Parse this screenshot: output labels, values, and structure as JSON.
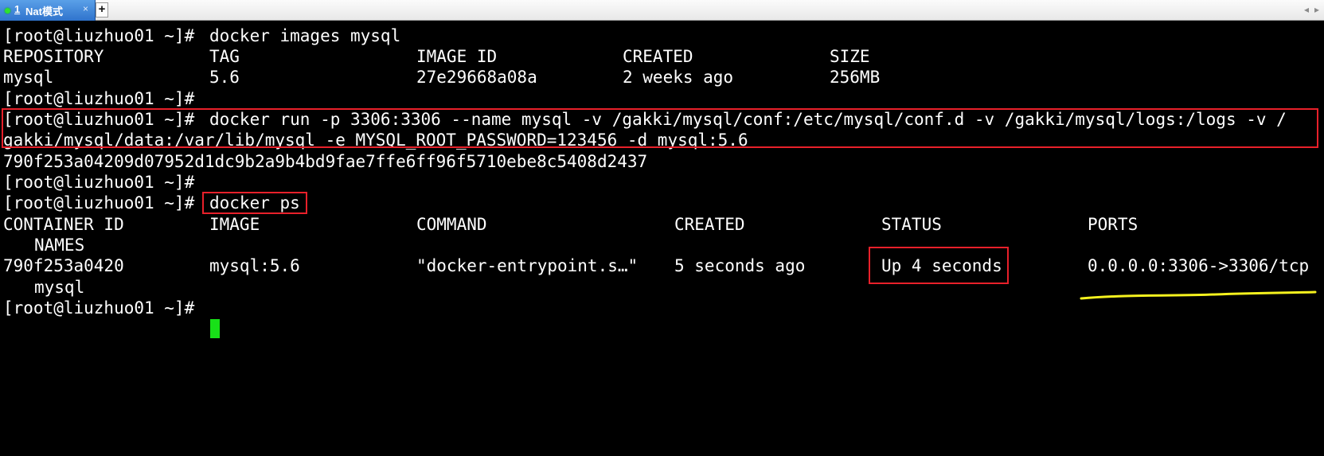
{
  "tab": {
    "number": "1",
    "name": "Nat模式",
    "close": "×",
    "add": "+",
    "nav_left": "◂",
    "nav_right": "▸",
    "status_color": "#2fe02f"
  },
  "terminal": {
    "prompt": "[root@liuzhuo01 ~]#",
    "cmd_images": "docker images mysql",
    "images_header": [
      "REPOSITORY",
      "TAG",
      "IMAGE ID",
      "CREATED",
      "SIZE"
    ],
    "images_row": [
      "mysql",
      "5.6",
      "27e29668a08a",
      "2 weeks ago",
      "256MB"
    ],
    "cmd_run_part1": "docker run -p 3306:3306 --name mysql -v /gakki/mysql/conf:/etc/mysql/conf.d -v /gakki/mysql/logs:/logs -v /",
    "cmd_run_part2": "gakki/mysql/data:/var/lib/mysql -e MYSQL_ROOT_PASSWORD=123456 -d mysql:5.6",
    "container_hash": "790f253a04209d07952d1dc9b2a9b4bd9fae7ffe6ff96f5710ebe8c5408d2437",
    "cmd_ps": "docker ps",
    "ps_header": [
      "CONTAINER ID",
      "IMAGE",
      "COMMAND",
      "CREATED",
      "STATUS",
      "PORTS"
    ],
    "ps_header_names": "NAMES",
    "ps_row": [
      "790f253a0420",
      "mysql:5.6",
      "\"docker-entrypoint.s…\"",
      "5 seconds ago",
      "Up 4 seconds",
      "0.0.0.0:3306->3306/tcp"
    ],
    "ps_row_name": "mysql",
    "cursor_color": "#18e018"
  },
  "annotations": {
    "box_color": "#e8202a",
    "underline_color": "#f5f21e"
  }
}
